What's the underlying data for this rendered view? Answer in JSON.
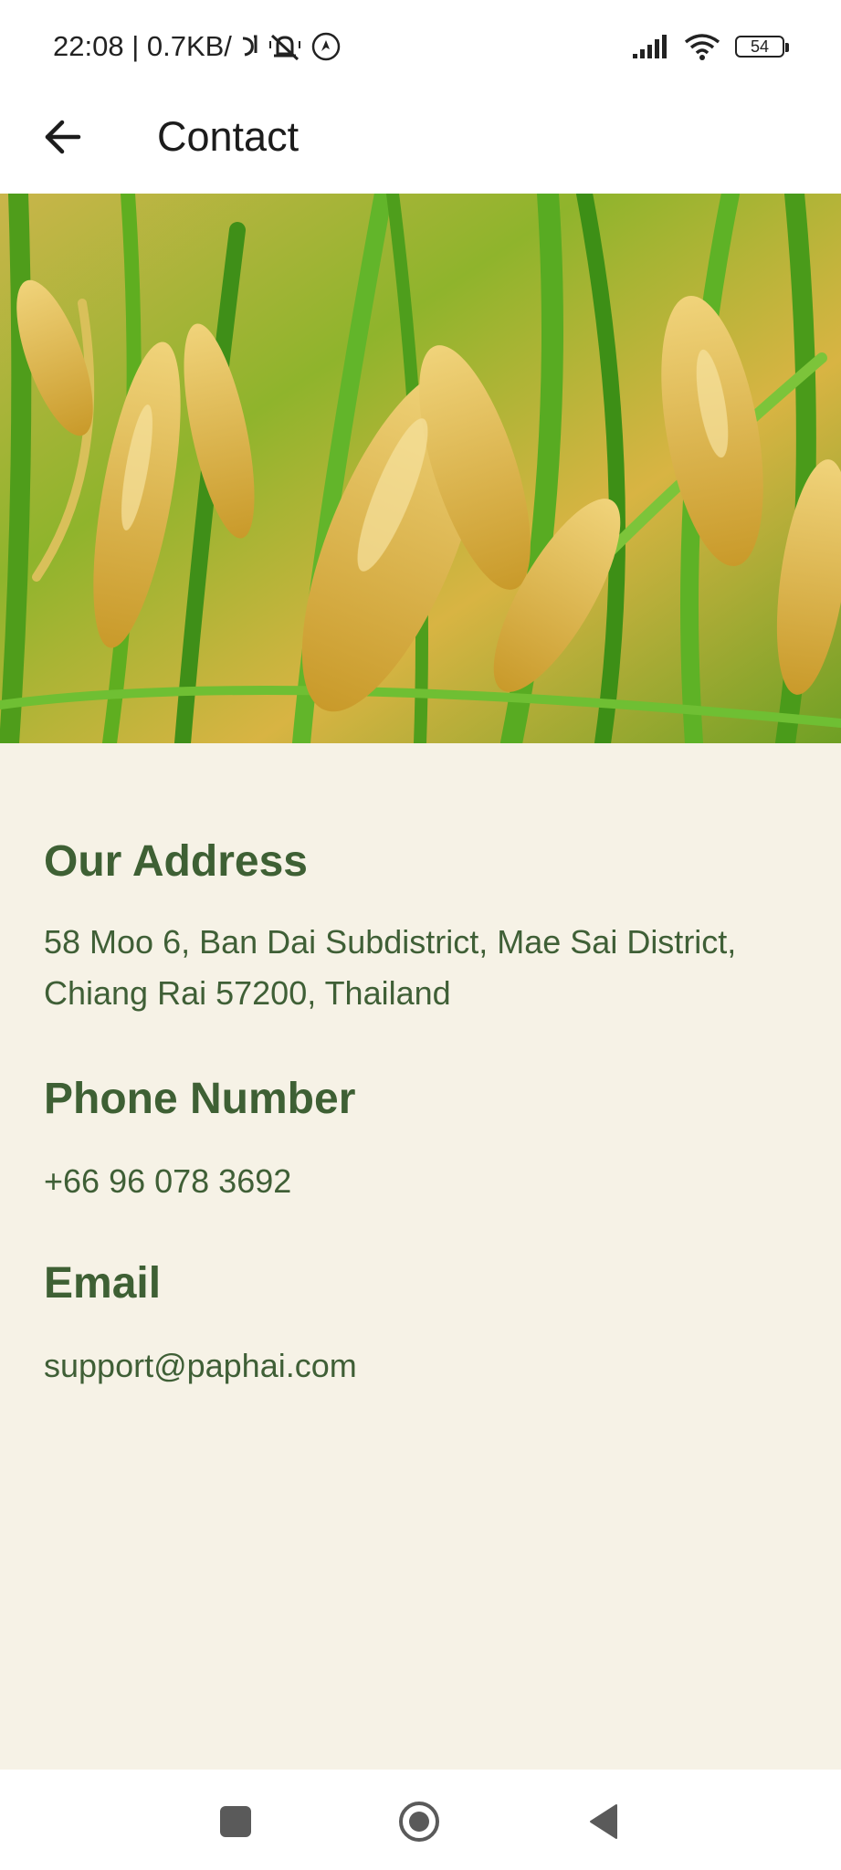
{
  "status_bar": {
    "time_and_speed": "22:08 | 0.7KB/",
    "battery_level": "54",
    "icons": [
      "wifi-calling-icon",
      "muted-bell-icon",
      "app-notification-icon",
      "signal-icon",
      "wifi-icon",
      "battery-icon"
    ]
  },
  "app_bar": {
    "title": "Contact",
    "back_icon": "arrow-left-icon"
  },
  "hero": {
    "image_subject": "rice-field-image"
  },
  "contact": {
    "address_heading": "Our Address",
    "address_text": "58 Moo 6, Ban Dai Subdistrict, Mae Sai District, Chiang Rai 57200, Thailand",
    "phone_heading": "Phone Number",
    "phone_text": "+66 96 078 3692",
    "email_heading": "Email",
    "email_text": "support@paphai.com"
  },
  "nav_bar": {
    "icons": [
      "recent-apps-icon",
      "home-icon",
      "back-triangle-icon"
    ]
  },
  "colors": {
    "content_background": "#f6f2e6",
    "heading_green": "#3e6034",
    "text_green": "#3f5f36"
  }
}
